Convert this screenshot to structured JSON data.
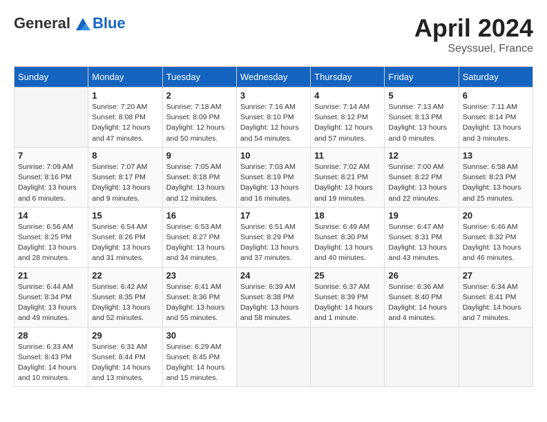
{
  "header": {
    "logo_general": "General",
    "logo_blue": "Blue",
    "month": "April 2024",
    "location": "Seyssuel, France"
  },
  "columns": [
    "Sunday",
    "Monday",
    "Tuesday",
    "Wednesday",
    "Thursday",
    "Friday",
    "Saturday"
  ],
  "weeks": [
    [
      {
        "day": "",
        "info": ""
      },
      {
        "day": "1",
        "info": "Sunrise: 7:20 AM\nSunset: 8:08 PM\nDaylight: 12 hours and 47 minutes."
      },
      {
        "day": "2",
        "info": "Sunrise: 7:18 AM\nSunset: 8:09 PM\nDaylight: 12 hours and 50 minutes."
      },
      {
        "day": "3",
        "info": "Sunrise: 7:16 AM\nSunset: 8:10 PM\nDaylight: 12 hours and 54 minutes."
      },
      {
        "day": "4",
        "info": "Sunrise: 7:14 AM\nSunset: 8:12 PM\nDaylight: 12 hours and 57 minutes."
      },
      {
        "day": "5",
        "info": "Sunrise: 7:13 AM\nSunset: 8:13 PM\nDaylight: 13 hours and 0 minutes."
      },
      {
        "day": "6",
        "info": "Sunrise: 7:11 AM\nSunset: 8:14 PM\nDaylight: 13 hours and 3 minutes."
      }
    ],
    [
      {
        "day": "7",
        "info": "Sunrise: 7:09 AM\nSunset: 8:16 PM\nDaylight: 13 hours and 6 minutes."
      },
      {
        "day": "8",
        "info": "Sunrise: 7:07 AM\nSunset: 8:17 PM\nDaylight: 13 hours and 9 minutes."
      },
      {
        "day": "9",
        "info": "Sunrise: 7:05 AM\nSunset: 8:18 PM\nDaylight: 13 hours and 12 minutes."
      },
      {
        "day": "10",
        "info": "Sunrise: 7:03 AM\nSunset: 8:19 PM\nDaylight: 13 hours and 16 minutes."
      },
      {
        "day": "11",
        "info": "Sunrise: 7:02 AM\nSunset: 8:21 PM\nDaylight: 13 hours and 19 minutes."
      },
      {
        "day": "12",
        "info": "Sunrise: 7:00 AM\nSunset: 8:22 PM\nDaylight: 13 hours and 22 minutes."
      },
      {
        "day": "13",
        "info": "Sunrise: 6:58 AM\nSunset: 8:23 PM\nDaylight: 13 hours and 25 minutes."
      }
    ],
    [
      {
        "day": "14",
        "info": "Sunrise: 6:56 AM\nSunset: 8:25 PM\nDaylight: 13 hours and 28 minutes."
      },
      {
        "day": "15",
        "info": "Sunrise: 6:54 AM\nSunset: 8:26 PM\nDaylight: 13 hours and 31 minutes."
      },
      {
        "day": "16",
        "info": "Sunrise: 6:53 AM\nSunset: 8:27 PM\nDaylight: 13 hours and 34 minutes."
      },
      {
        "day": "17",
        "info": "Sunrise: 6:51 AM\nSunset: 8:29 PM\nDaylight: 13 hours and 37 minutes."
      },
      {
        "day": "18",
        "info": "Sunrise: 6:49 AM\nSunset: 8:30 PM\nDaylight: 13 hours and 40 minutes."
      },
      {
        "day": "19",
        "info": "Sunrise: 6:47 AM\nSunset: 8:31 PM\nDaylight: 13 hours and 43 minutes."
      },
      {
        "day": "20",
        "info": "Sunrise: 6:46 AM\nSunset: 8:32 PM\nDaylight: 13 hours and 46 minutes."
      }
    ],
    [
      {
        "day": "21",
        "info": "Sunrise: 6:44 AM\nSunset: 8:34 PM\nDaylight: 13 hours and 49 minutes."
      },
      {
        "day": "22",
        "info": "Sunrise: 6:42 AM\nSunset: 8:35 PM\nDaylight: 13 hours and 52 minutes."
      },
      {
        "day": "23",
        "info": "Sunrise: 6:41 AM\nSunset: 8:36 PM\nDaylight: 13 hours and 55 minutes."
      },
      {
        "day": "24",
        "info": "Sunrise: 6:39 AM\nSunset: 8:38 PM\nDaylight: 13 hours and 58 minutes."
      },
      {
        "day": "25",
        "info": "Sunrise: 6:37 AM\nSunset: 8:39 PM\nDaylight: 14 hours and 1 minute."
      },
      {
        "day": "26",
        "info": "Sunrise: 6:36 AM\nSunset: 8:40 PM\nDaylight: 14 hours and 4 minutes."
      },
      {
        "day": "27",
        "info": "Sunrise: 6:34 AM\nSunset: 8:41 PM\nDaylight: 14 hours and 7 minutes."
      }
    ],
    [
      {
        "day": "28",
        "info": "Sunrise: 6:33 AM\nSunset: 8:43 PM\nDaylight: 14 hours and 10 minutes."
      },
      {
        "day": "29",
        "info": "Sunrise: 6:31 AM\nSunset: 8:44 PM\nDaylight: 14 hours and 13 minutes."
      },
      {
        "day": "30",
        "info": "Sunrise: 6:29 AM\nSunset: 8:45 PM\nDaylight: 14 hours and 15 minutes."
      },
      {
        "day": "",
        "info": ""
      },
      {
        "day": "",
        "info": ""
      },
      {
        "day": "",
        "info": ""
      },
      {
        "day": "",
        "info": ""
      }
    ]
  ]
}
